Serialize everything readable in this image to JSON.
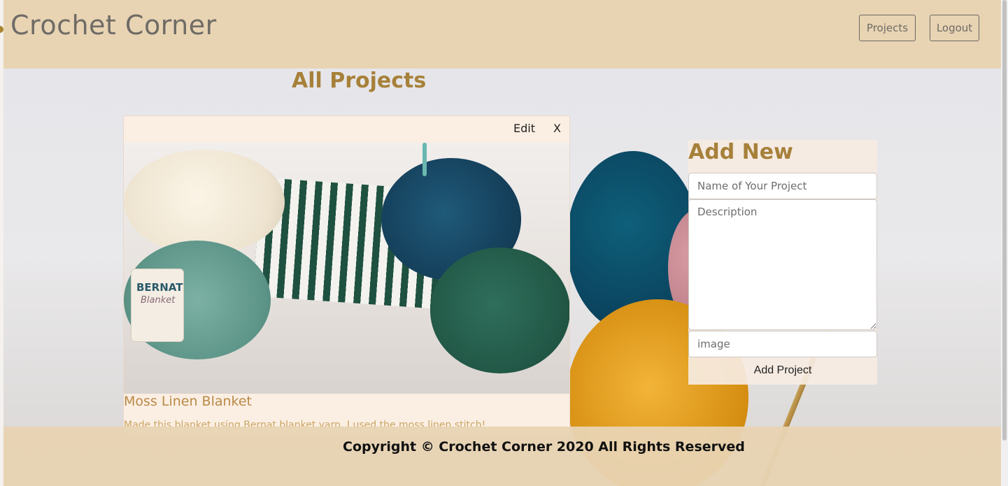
{
  "app": {
    "brand": "Crochet Corner"
  },
  "nav": {
    "projects_label": "Projects",
    "logout_label": "Logout"
  },
  "page": {
    "title": "All Projects"
  },
  "project_card": {
    "edit_label": "Edit",
    "close_label": "X",
    "title": "Moss Linen Blanket",
    "description": "Made this blanket using Bernat blanket yarn. I used the moss linen stitch!",
    "image_label_brand": "BERNAT",
    "image_label_sub": "Blanket"
  },
  "add_form": {
    "title": "Add New",
    "name_placeholder": "Name of Your Project",
    "description_placeholder": "Description",
    "image_placeholder": "image",
    "submit_label": "Add Project"
  },
  "footer": {
    "copyright": "Copyright © Crochet Corner 2020 All Rights Reserved"
  },
  "colors": {
    "header_bg": "#e8d4b3",
    "accent_gold": "#a7813a",
    "card_bg": "#fbeee3"
  }
}
